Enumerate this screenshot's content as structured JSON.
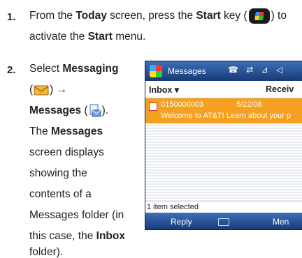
{
  "step1": {
    "number": "1.",
    "line1_pre": "From the ",
    "today": "Today",
    "line1_mid": " screen, press the ",
    "start": "Start",
    "line1_key": " key (",
    "line1_end": ") to",
    "line2_pre": "activate the ",
    "start_menu": "Start",
    "line2_end": " menu."
  },
  "step2": {
    "number": "2.",
    "select": "Select ",
    "messaging": "Messaging",
    "paren_open": "(",
    "arrow": ") →",
    "messages": "Messages",
    "messages_tail": " (",
    "close": ").",
    "the": "The ",
    "messages_bold": "Messages",
    "l4": "screen displays",
    "l5": "showing the",
    "l6": "contents of a",
    "l7": "Messages folder (in",
    "l8_pre": "this case, the ",
    "inbox": "Inbox",
    "l9": "folder)."
  },
  "phone": {
    "title": "Messages",
    "status_icons": "☎ ⇄ ⊿ ◁",
    "folder": "Inbox ▾",
    "received": "Receiv",
    "message": {
      "from": "0150000003",
      "date": "5/22/08",
      "preview": "Welcome to AT&T! Learn about your p"
    },
    "selection": "1 item selected",
    "left_softkey": "Reply",
    "right_softkey": "Men"
  }
}
